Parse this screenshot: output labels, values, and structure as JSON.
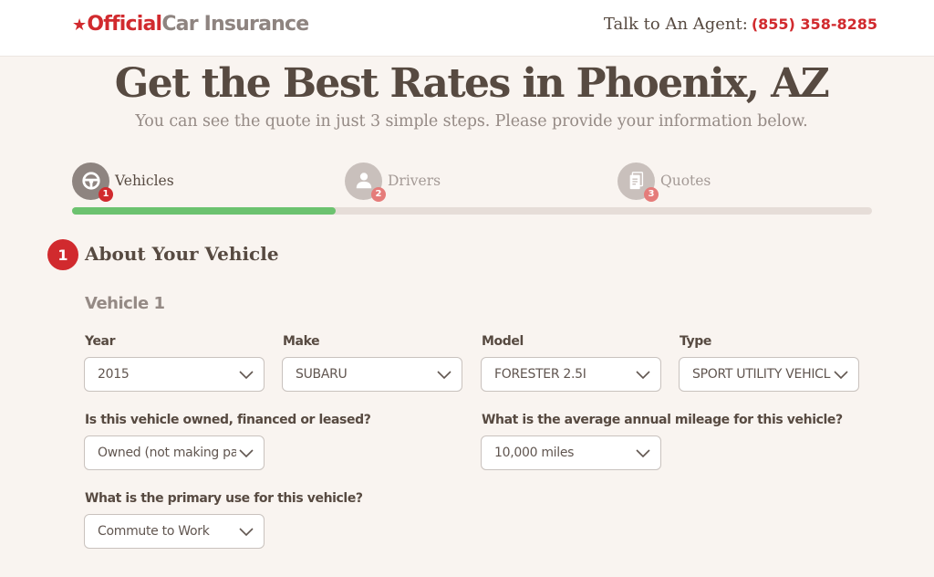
{
  "header": {
    "logo_official": "Official",
    "logo_rest": "Car Insurance",
    "agent_label": "Talk to An Agent:",
    "agent_phone": "(855) 358-8285"
  },
  "hero": {
    "title": "Get the Best Rates in Phoenix, AZ",
    "subtitle": "You can see the quote in just 3 simple steps. Please provide your information below."
  },
  "steps": [
    {
      "label": "Vehicles",
      "number": "1",
      "icon": "steering-wheel-icon",
      "active": true
    },
    {
      "label": "Drivers",
      "number": "2",
      "icon": "person-icon",
      "active": false
    },
    {
      "label": "Quotes",
      "number": "3",
      "icon": "document-icon",
      "active": false
    }
  ],
  "progress": {
    "fraction": 0.33,
    "color": "#6cc26f"
  },
  "section": {
    "number": "1",
    "title": "About Your Vehicle",
    "vehicle_title": "Vehicle 1"
  },
  "fields": {
    "year": {
      "label": "Year",
      "value": "2015"
    },
    "make": {
      "label": "Make",
      "value": "SUBARU"
    },
    "model": {
      "label": "Model",
      "value": "FORESTER 2.5I"
    },
    "type": {
      "label": "Type",
      "value": "SPORT UTILITY VEHICLE"
    },
    "ownership": {
      "label": "Is this vehicle owned, financed or leased?",
      "value": "Owned (not making payments)"
    },
    "mileage": {
      "label": "What is the average annual mileage for this vehicle?",
      "value": "10,000 miles"
    },
    "use": {
      "label": "What is the primary use for this vehicle?",
      "value": "Commute to Work"
    }
  },
  "colors": {
    "brand_red": "#d12a2e",
    "text_dark": "#574a41",
    "text_muted": "#958a85",
    "background": "#f9f4f0"
  }
}
